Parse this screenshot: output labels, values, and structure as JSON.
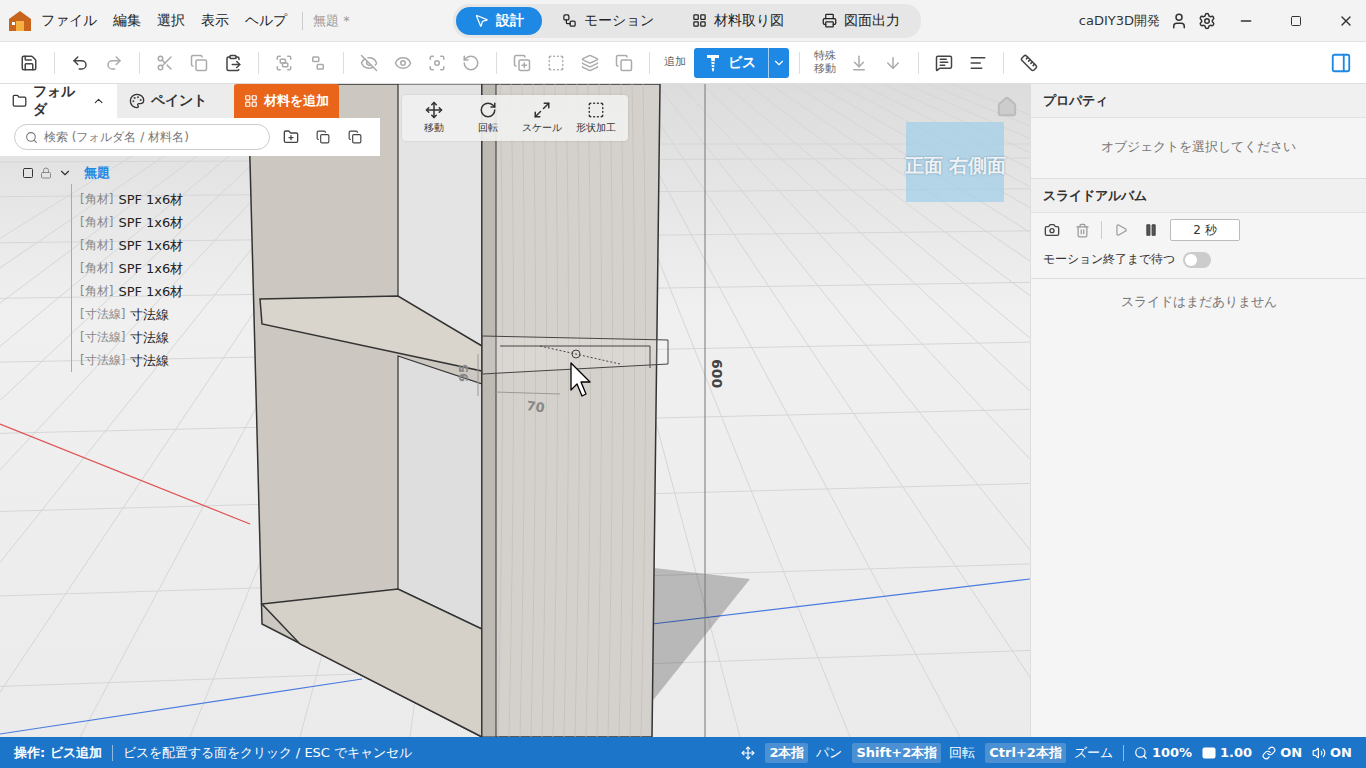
{
  "app": {
    "title": "無題 *",
    "menu": [
      "ファイル",
      "編集",
      "選択",
      "表示",
      "ヘルプ"
    ],
    "mode_tabs": [
      {
        "label": "設計",
        "kind": "design",
        "selected": true
      },
      {
        "label": "モーション",
        "kind": "motion",
        "selected": false
      },
      {
        "label": "材料取り図",
        "kind": "cutlist",
        "selected": false
      },
      {
        "label": "図面出力",
        "kind": "print",
        "selected": false
      }
    ],
    "user": "caDIY3D開発"
  },
  "toolbar": {
    "add_label": "追加",
    "screw_button": {
      "label": "ビス",
      "selected": true
    },
    "special_move_label": [
      "特殊",
      "移動"
    ]
  },
  "left_panel": {
    "tabs": [
      {
        "label": "フォルダ",
        "kind": "folder",
        "selected": true,
        "expanded": true
      },
      {
        "label": "ペイント",
        "kind": "paint",
        "selected": false,
        "expanded": false
      }
    ],
    "add_material": "材料を追加",
    "search_placeholder": "検索 (フォルダ名 / 材料名)",
    "tree": {
      "root": {
        "label": "無題",
        "expanded": true,
        "checked": false,
        "locked": false
      },
      "items": [
        {
          "type": "[角材]",
          "name": "SPF 1x6材"
        },
        {
          "type": "[角材]",
          "name": "SPF 1x6材"
        },
        {
          "type": "[角材]",
          "name": "SPF 1x6材"
        },
        {
          "type": "[角材]",
          "name": "SPF 1x6材"
        },
        {
          "type": "[角材]",
          "name": "SPF 1x6材"
        },
        {
          "type": "[寸法線]",
          "name": "寸法線"
        },
        {
          "type": "[寸法線]",
          "name": "寸法線"
        },
        {
          "type": "[寸法線]",
          "name": "寸法線"
        }
      ]
    }
  },
  "floating_tools": [
    {
      "label": "移動",
      "kind": "move"
    },
    {
      "label": "回転",
      "kind": "rotate"
    },
    {
      "label": "スケール",
      "kind": "scale"
    },
    {
      "label": "形状加工",
      "kind": "shape"
    }
  ],
  "view_cube": {
    "faces": [
      "正面",
      "右側面"
    ]
  },
  "scene": {
    "dimensions": [
      {
        "label": "95",
        "kind": "height"
      },
      {
        "label": "70",
        "kind": "width"
      },
      {
        "label": "600",
        "kind": "total"
      }
    ]
  },
  "properties": {
    "title": "プロパティ",
    "empty": "オブジェクトを選択してください"
  },
  "slide_album": {
    "title": "スライドアルバム",
    "interval": "2 秒",
    "wait_label": "モーション終了まで待つ",
    "wait_on": false,
    "empty": "スライドはまだありません"
  },
  "status_bar": {
    "operation": "操作: ビス追加",
    "hint": "ビスを配置する面をクリック / ESC でキャンセル",
    "gestures": [
      {
        "key": "2本指",
        "action": "パン"
      },
      {
        "key": "Shift+2本指",
        "action": "回転"
      },
      {
        "key": "Ctrl+2本指",
        "action": "ズーム"
      }
    ],
    "zoom": "100%",
    "scale": "1.00",
    "link": "ON",
    "sound": "ON"
  }
}
